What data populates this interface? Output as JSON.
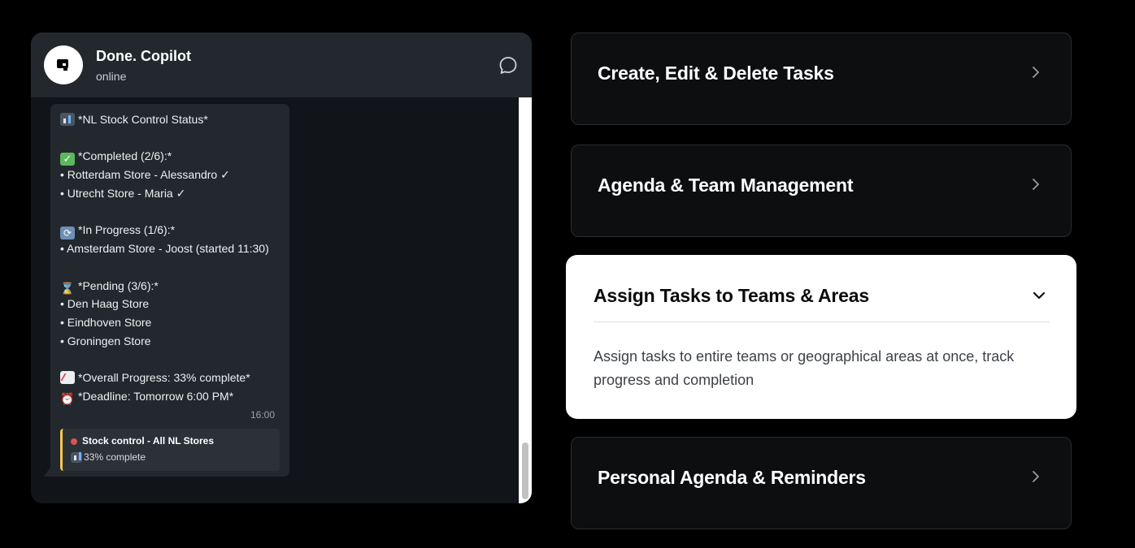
{
  "chat": {
    "title": "Done. Copilot",
    "status": "online",
    "icons": {
      "avatar": "copilot-logo-icon",
      "action": "chat-bubble-icon"
    },
    "message": {
      "line_title": "*NL Stock Control Status*",
      "line_completed": "*Completed (2/6):*",
      "line_c1": "• Rotterdam Store - Alessandro ✓",
      "line_c2": "• Utrecht Store - Maria ✓",
      "line_inprogress": "*In Progress (1/6):*",
      "line_ip1": "• Amsterdam Store - Joost (started 11:30)",
      "line_pending": "*Pending (3/6):*",
      "line_p1": "• Den Haag Store",
      "line_p2": "• Eindhoven Store",
      "line_p3": "• Groningen Store",
      "line_overall": "*Overall Progress: 33% complete*",
      "line_deadline": "*Deadline: Tomorrow 6:00 PM*",
      "time": "16:00",
      "emoji": [
        "bar-chart-icon",
        "check-mark-icon",
        "sync-icon",
        "hourglass-icon",
        "trend-up-icon",
        "alarm-clock-icon"
      ]
    },
    "card": {
      "title": "Stock control - All NL Stores",
      "subtitle": "33% complete",
      "status_color": "#d9534f",
      "accent_color": "#f2c94c"
    }
  },
  "accordion": {
    "items": [
      {
        "label": "Create, Edit & Delete Tasks",
        "expanded": false
      },
      {
        "label": "Agenda & Team Management",
        "expanded": false
      },
      {
        "label": "Assign Tasks to Teams & Areas",
        "expanded": true,
        "description": "Assign tasks to entire teams or geographical areas at once, track progress and completion"
      },
      {
        "label": "Personal Agenda & Reminders",
        "expanded": false
      }
    ]
  }
}
